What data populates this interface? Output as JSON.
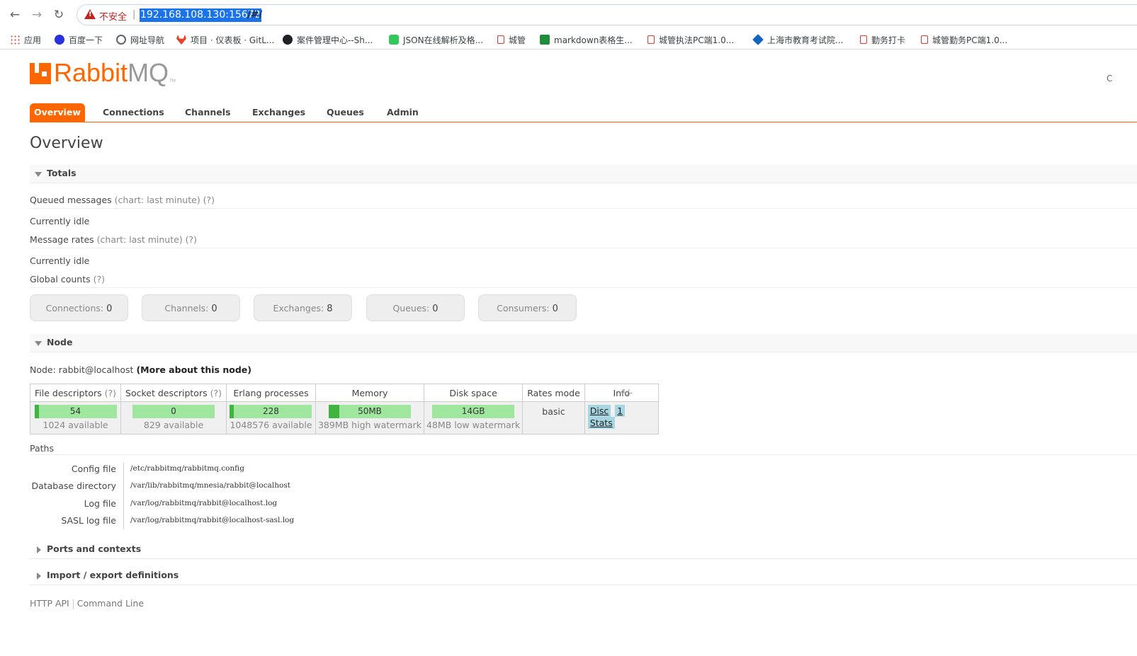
{
  "browser": {
    "security_label": "不安全",
    "separator": "|",
    "url_host": "192.168.108.130:15672",
    "url_rest": "/#/",
    "bookmarks": [
      {
        "label": "应用",
        "icon": "apps-grid-icon",
        "color": "#1a73e8"
      },
      {
        "label": "百度一下",
        "icon": "baidu-icon",
        "color": "#2932e1"
      },
      {
        "label": "网址导航",
        "icon": "globe-icon",
        "color": "#5f6368"
      },
      {
        "label": "项目 · 仪表板 · GitL...",
        "icon": "gitlab-icon",
        "color": "#e24329"
      },
      {
        "label": "案件管理中心--Sh...",
        "icon": "github-icon",
        "color": "#202124"
      },
      {
        "label": "JSON在线解析及格...",
        "icon": "json-icon",
        "color": "#34c759"
      },
      {
        "label": "城管",
        "icon": "page-icon",
        "color": "#e53935"
      },
      {
        "label": "markdown表格生...",
        "icon": "table-icon",
        "color": "#1e8e3e"
      },
      {
        "label": "城管执法PC端1.0...",
        "icon": "page-icon",
        "color": "#e53935"
      },
      {
        "label": "上海市教育考试院...",
        "icon": "diamond-icon",
        "color": "#1565c0"
      },
      {
        "label": "勤务打卡",
        "icon": "page-icon",
        "color": "#e53935"
      },
      {
        "label": "城管勤务PC端1.0...",
        "icon": "page-icon",
        "color": "#e53935"
      }
    ]
  },
  "app": {
    "logo_rabbit": "Rabbit",
    "logo_mq": "MQ",
    "logo_tm": "TM",
    "edge_letter": "C",
    "tabs": [
      "Overview",
      "Connections",
      "Channels",
      "Exchanges",
      "Queues",
      "Admin"
    ],
    "active_tab": "Overview",
    "page_title": "Overview"
  },
  "totals": {
    "label": "Totals",
    "queued_messages": "Queued messages",
    "queued_note": "(chart: last minute) (?)",
    "queued_status": "Currently idle",
    "message_rates": "Message rates",
    "rates_note": "(chart: last minute) (?)",
    "rates_status": "Currently idle",
    "global_counts": "Global counts",
    "global_note": "(?)",
    "counts": [
      {
        "label": "Connections:",
        "value": "0"
      },
      {
        "label": "Channels:",
        "value": "0"
      },
      {
        "label": "Exchanges:",
        "value": "8"
      },
      {
        "label": "Queues:",
        "value": "0"
      },
      {
        "label": "Consumers:",
        "value": "0"
      }
    ]
  },
  "node": {
    "label": "Node",
    "node_prefix": "Node: rabbit@localhost",
    "more_link": "(More about this node)",
    "headers": {
      "file_descriptors": "File descriptors",
      "socket_descriptors": "Socket descriptors",
      "erlang_processes": "Erlang processes",
      "memory": "Memory",
      "disk_space": "Disk space",
      "rates_mode": "Rates mode",
      "info": "Info",
      "help": "(?)"
    },
    "file_descriptors": {
      "value": "54",
      "available": "1024 available",
      "fraction": 0.053
    },
    "socket_descriptors": {
      "value": "0",
      "available": "829 available",
      "fraction": 0
    },
    "erlang_processes": {
      "value": "228",
      "available": "1048576 available",
      "fraction": 0.0002
    },
    "memory": {
      "value": "50MB",
      "available": "389MB high watermark",
      "fraction": 0.13
    },
    "disk_space": {
      "value": "14GB",
      "available": "48MB low watermark",
      "fraction": 0
    },
    "rates_mode": "basic",
    "info_badges": [
      "Disc",
      "1",
      "Stats"
    ],
    "plus_minus": "+/-"
  },
  "paths": {
    "label": "Paths",
    "rows": [
      {
        "label": "Config file",
        "value": "/etc/rabbitmq/rabbitmq.config"
      },
      {
        "label": "Database directory",
        "value": "/var/lib/rabbitmq/mnesia/rabbit@localhost"
      },
      {
        "label": "Log file",
        "value": "/var/log/rabbitmq/rabbit@localhost.log"
      },
      {
        "label": "SASL log file",
        "value": "/var/log/rabbitmq/rabbit@localhost-sasl.log"
      }
    ]
  },
  "collapsed_sections": {
    "ports": "Ports and contexts",
    "import_export": "Import / export definitions"
  },
  "footer": {
    "http_api": "HTTP API",
    "command_line": "Command Line"
  }
}
